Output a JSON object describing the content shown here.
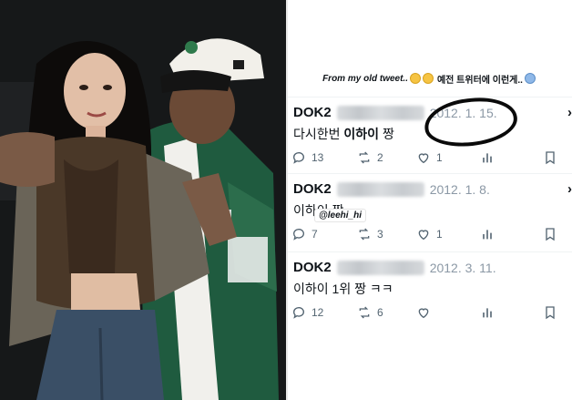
{
  "caption": {
    "text": "From my old tweet..",
    "korean": "예전 트위터에 이런게..",
    "emojis": [
      "grinning-sweat-face-icon",
      "grinning-sweat-face-icon",
      "fearful-face-icon"
    ]
  },
  "tweets": [
    {
      "name": "DOK2",
      "date": "2012. 1. 15.",
      "text_plain": "다시한번 ",
      "text_bold": "이하이",
      "text_tail": " 짱",
      "reply_count": "13",
      "retweet_count": "2",
      "like_count": "1"
    },
    {
      "name": "DOK2",
      "date": "2012. 1. 8.",
      "text_plain": "이하이 짱",
      "text_bold": "",
      "text_tail": "",
      "reply_count": "7",
      "retweet_count": "3",
      "like_count": "1"
    },
    {
      "name": "DOK2",
      "date": "2012. 3. 11.",
      "text_plain": "이하이 1위 짱 ㅋㅋ",
      "text_bold": "",
      "text_tail": "",
      "reply_count": "12",
      "retweet_count": "6",
      "like_count": ""
    }
  ],
  "mention_tag": "@leehi_hi",
  "colors": {
    "text": "#0f1419",
    "muted": "#536471",
    "date": "#8b98a5",
    "photo_bg": "#1a1c1e",
    "jacket_green": "#1f5b3f",
    "fur_brown": "#4a3828",
    "cap_white": "#f2f0ea"
  }
}
